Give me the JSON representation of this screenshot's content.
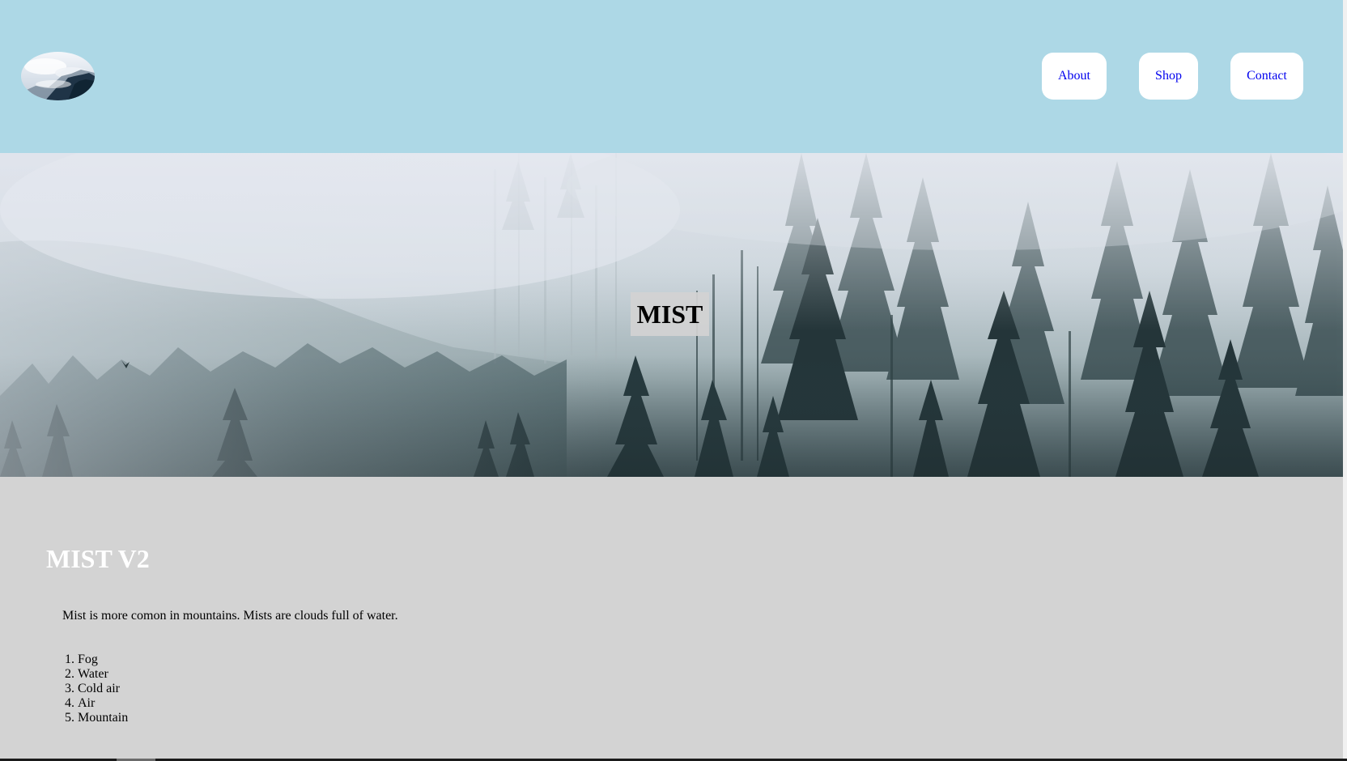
{
  "header": {
    "logo_icon": "misty-mountain-logo",
    "nav": [
      {
        "label": "About"
      },
      {
        "label": "Shop"
      },
      {
        "label": "Contact"
      }
    ]
  },
  "hero": {
    "image": "misty-forest",
    "title": "MIST"
  },
  "content": {
    "title": "MIST V2",
    "paragraph": "Mist is more comon in mountains. Mists are clouds full of water.",
    "list": [
      "Fog",
      "Water",
      "Cold air",
      "Air",
      "Mountain"
    ]
  },
  "colors": {
    "header_bg": "#add8e6",
    "content_bg": "#d3d3d3",
    "link": "#0000ee",
    "heading": "#ffffff"
  }
}
